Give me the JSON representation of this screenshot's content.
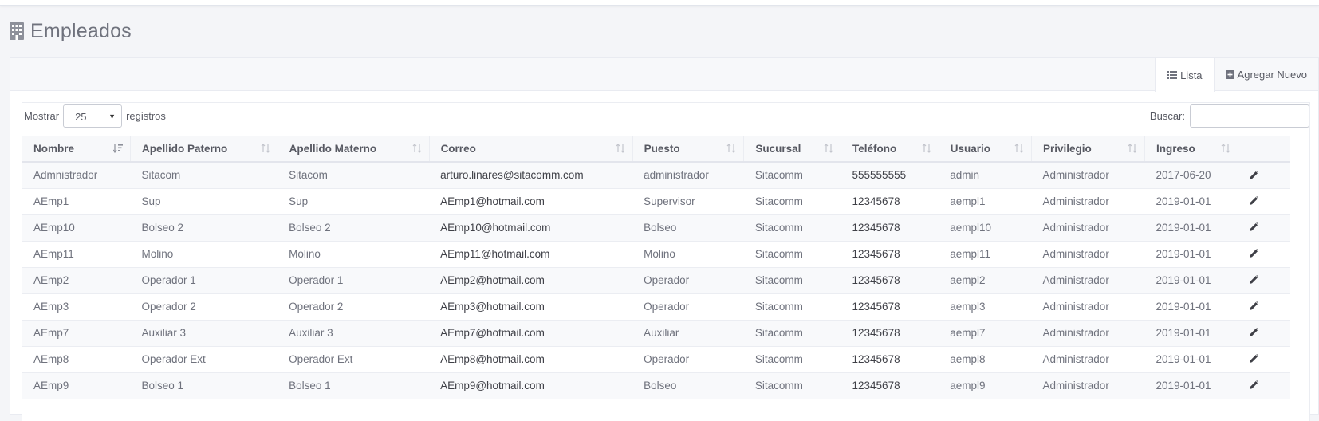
{
  "page": {
    "title": "Empleados",
    "icon": "building-icon"
  },
  "tabs": [
    {
      "label": "Lista",
      "icon": "list-icon",
      "active": true
    },
    {
      "label": "Agregar Nuevo",
      "icon": "plus-square-icon",
      "active": false
    }
  ],
  "controls": {
    "show_label": "Mostrar",
    "page_length": "25",
    "records_label": "registros",
    "search_label": "Buscar:",
    "search_value": ""
  },
  "table": {
    "columns": [
      "Nombre",
      "Apellido Paterno",
      "Apellido Materno",
      "Correo",
      "Puesto",
      "Sucursal",
      "Teléfono",
      "Usuario",
      "Privilegio",
      "Ingreso",
      ""
    ],
    "sorted_column": "Nombre",
    "sort_direction": "asc",
    "rows": [
      [
        "Admnistrador",
        "Sitacom",
        "Sitacom",
        "arturo.linares@sitacomm.com",
        "administrador",
        "Sitacomm",
        "555555555",
        "admin",
        "Administrador",
        "2017-06-20"
      ],
      [
        "AEmp1",
        "Sup",
        "Sup",
        "AEmp1@hotmail.com",
        "Supervisor",
        "Sitacomm",
        "12345678",
        "aempl1",
        "Administrador",
        "2019-01-01"
      ],
      [
        "AEmp10",
        "Bolseo 2",
        "Bolseo 2",
        "AEmp10@hotmail.com",
        "Bolseo",
        "Sitacomm",
        "12345678",
        "aempl10",
        "Administrador",
        "2019-01-01"
      ],
      [
        "AEmp11",
        "Molino",
        "Molino",
        "AEmp11@hotmail.com",
        "Molino",
        "Sitacomm",
        "12345678",
        "aempl11",
        "Administrador",
        "2019-01-01"
      ],
      [
        "AEmp2",
        "Operador 1",
        "Operador 1",
        "AEmp2@hotmail.com",
        "Operador",
        "Sitacomm",
        "12345678",
        "aempl2",
        "Administrador",
        "2019-01-01"
      ],
      [
        "AEmp3",
        "Operador 2",
        "Operador 2",
        "AEmp3@hotmail.com",
        "Operador",
        "Sitacomm",
        "12345678",
        "aempl3",
        "Administrador",
        "2019-01-01"
      ],
      [
        "AEmp7",
        "Auxiliar 3",
        "Auxiliar 3",
        "AEmp7@hotmail.com",
        "Auxiliar",
        "Sitacomm",
        "12345678",
        "aempl7",
        "Administrador",
        "2019-01-01"
      ],
      [
        "AEmp8",
        "Operador Ext",
        "Operador Ext",
        "AEmp8@hotmail.com",
        "Operador",
        "Sitacomm",
        "12345678",
        "aempl8",
        "Administrador",
        "2019-01-01"
      ],
      [
        "AEmp9",
        "Bolseo 1",
        "Bolseo 1",
        "AEmp9@hotmail.com",
        "Bolseo",
        "Sitacomm",
        "12345678",
        "aempl9",
        "Administrador",
        "2019-01-01"
      ]
    ],
    "row_action_icon": "pencil-icon"
  },
  "colors": {
    "background": "#f4f5f8",
    "panel": "#ffffff",
    "header_bg": "#f7f8fa",
    "text": "#575962",
    "muted_text": "#6f727d"
  }
}
